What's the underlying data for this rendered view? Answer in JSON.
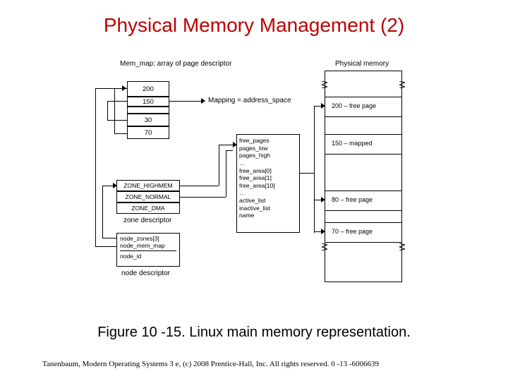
{
  "title": "Physical Memory Management (2)",
  "caption": "Figure 10 -15. Linux main memory representation.",
  "footer": "Tanenbaum, Modern Operating Systems 3 e, (c) 2008 Prentice-Hall, Inc. All rights reserved. 0 -13 -6006639",
  "diagram": {
    "mem_map_label": "Mem_map: array\nof page descriptor",
    "page_descriptors": [
      "200",
      "150",
      "30",
      "70"
    ],
    "mapping_label": "Mapping = address_space",
    "zones_label_HM": "ZONE_HIGHMEM",
    "zones_label_NO": "ZONE_NORMAL",
    "zones_label_DMA": "ZONE_DMA",
    "zone_descriptor_caption": "zone descriptor",
    "node_desc_line1": "node_zones[3]",
    "node_desc_line2": "node_mem_map",
    "node_desc_line3": "node_id",
    "node_descriptor_caption": "node descriptor",
    "free_box_line1": "free_pages",
    "free_box_line2": "pages_low",
    "free_box_line3": "pages_high",
    "free_box_ell1": "…",
    "free_box_line4": "free_area[0]",
    "free_box_line5": "free_area[1]",
    "free_box_line6": "free_area[10]",
    "free_box_ell2": "…",
    "free_box_line7": "active_list",
    "free_box_line8": "inactive_list",
    "free_box_line9": "name",
    "phys_mem_label": "Physical memory",
    "phys_row1": "200 – free page",
    "phys_row2": "150 – mapped",
    "phys_row3": "80 – free page",
    "phys_row4": "70 – free page"
  }
}
